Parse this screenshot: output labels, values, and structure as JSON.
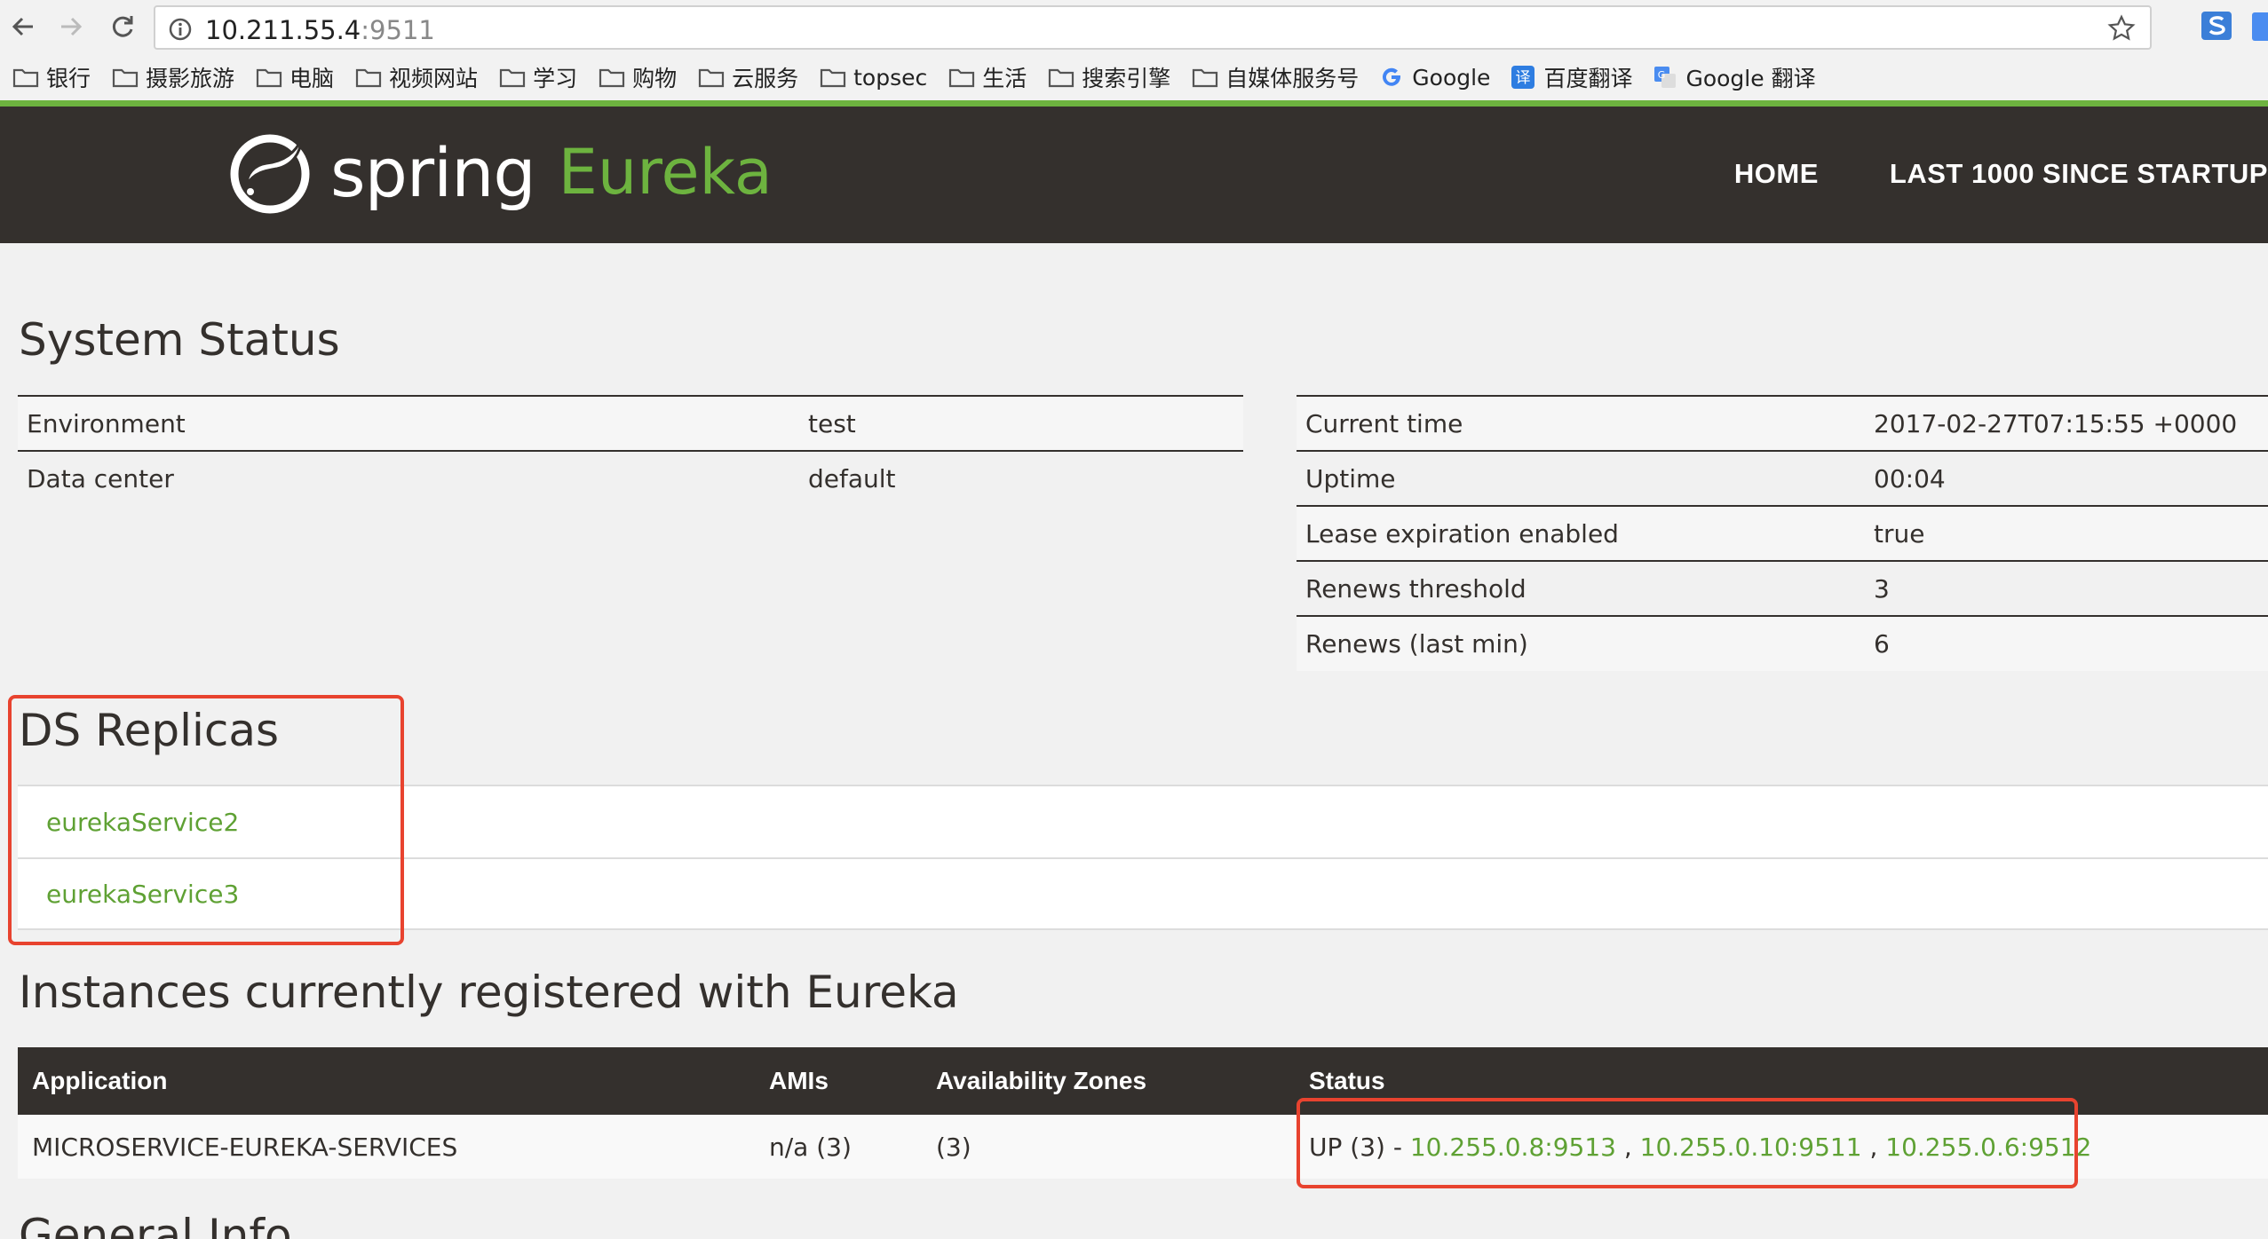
{
  "browser": {
    "url_host": "10.211.55.4",
    "url_port": ":9511",
    "bookmarks": [
      {
        "label": "银行",
        "icon": "folder-icon"
      },
      {
        "label": "摄影旅游",
        "icon": "folder-icon"
      },
      {
        "label": "电脑",
        "icon": "folder-icon"
      },
      {
        "label": "视频网站",
        "icon": "folder-icon"
      },
      {
        "label": "学习",
        "icon": "folder-icon"
      },
      {
        "label": "购物",
        "icon": "folder-icon"
      },
      {
        "label": "云服务",
        "icon": "folder-icon"
      },
      {
        "label": "topsec",
        "icon": "folder-icon"
      },
      {
        "label": "生活",
        "icon": "folder-icon"
      },
      {
        "label": "搜索引擎",
        "icon": "folder-icon"
      },
      {
        "label": "自媒体服务号",
        "icon": "folder-icon"
      },
      {
        "label": "Google",
        "icon": "google-icon"
      },
      {
        "label": "百度翻译",
        "icon": "baidu-translate-icon"
      },
      {
        "label": "Google 翻译",
        "icon": "google-translate-icon"
      }
    ]
  },
  "header": {
    "brand_spring": "spring",
    "brand_eureka": "Eureka",
    "nav": [
      "HOME",
      "LAST 1000 SINCE STARTUP"
    ]
  },
  "system_status": {
    "title": "System Status",
    "left": [
      {
        "key": "Environment",
        "value": "test"
      },
      {
        "key": "Data center",
        "value": "default"
      }
    ],
    "right": [
      {
        "key": "Current time",
        "value": "2017-02-27T07:15:55 +0000"
      },
      {
        "key": "Uptime",
        "value": "00:04"
      },
      {
        "key": "Lease expiration enabled",
        "value": "true"
      },
      {
        "key": "Renews threshold",
        "value": "3"
      },
      {
        "key": "Renews (last min)",
        "value": "6"
      }
    ]
  },
  "ds_replicas": {
    "title": "DS Replicas",
    "items": [
      "eurekaService2",
      "eurekaService3"
    ]
  },
  "instances": {
    "title": "Instances currently registered with Eureka",
    "columns": [
      "Application",
      "AMIs",
      "Availability Zones",
      "Status"
    ],
    "rows": [
      {
        "application": "MICROSERVICE-EUREKA-SERVICES",
        "amis": "n/a (3)",
        "zones": "(3)",
        "status_prefix": "UP (3) - ",
        "links": [
          "10.255.0.8:9513",
          "10.255.0.10:9511",
          "10.255.0.6:9512"
        ],
        "separator": " , "
      }
    ]
  },
  "next_section_title": "General Info",
  "colors": {
    "accent_green": "#6db33f",
    "header_dark": "#34302d",
    "highlight_red": "#e8432f"
  }
}
